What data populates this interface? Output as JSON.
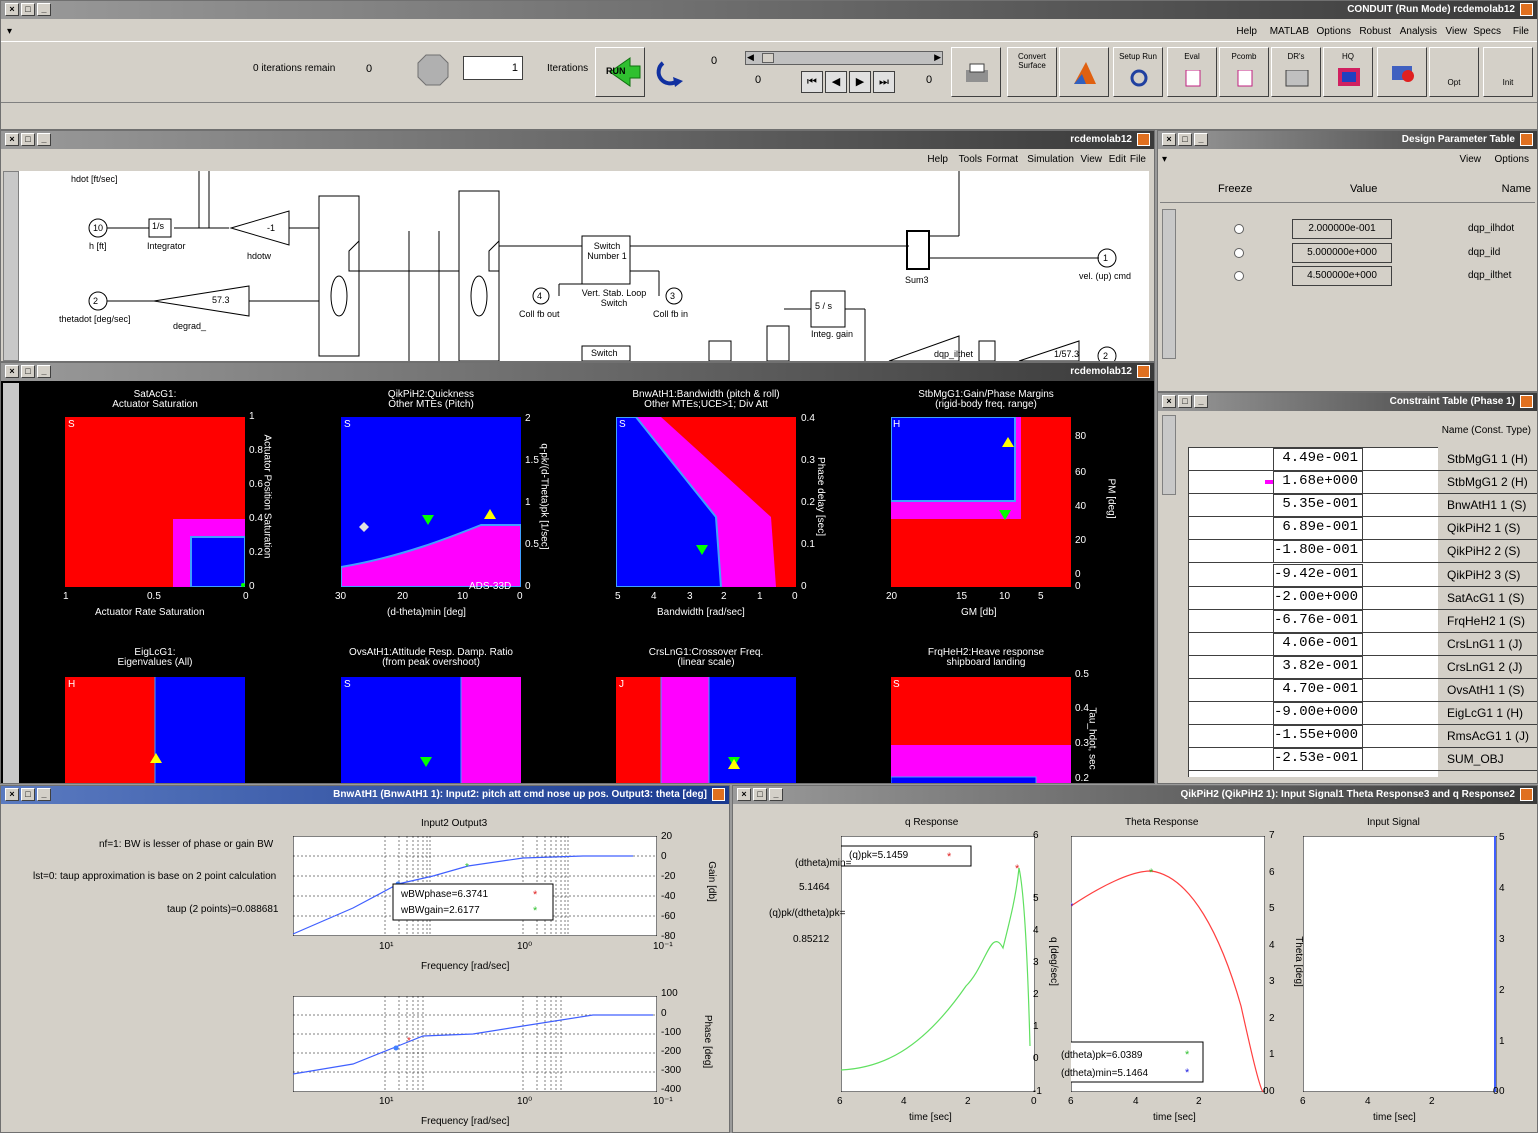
{
  "main": {
    "title": "CONDUIT (Run Mode)  rcdemolab12",
    "menus": [
      "File",
      "Specs",
      "View",
      "Analysis",
      "Robust",
      "Options",
      "MATLAB",
      "Help"
    ],
    "iterations_remain_value": "0",
    "iterations_remain_label": "0 iterations remain",
    "iterations_label": "Iterations",
    "iterations_value": "1",
    "run_label": "RUN",
    "slider_left": "0",
    "slider_mid": "0",
    "slider_right": "0",
    "toolbar_labels": [
      "Init",
      "Opt",
      "",
      "HQ",
      "DR's",
      "Pcomb",
      "Eval",
      "Setup Run",
      "",
      "Convert Surface",
      "",
      "Print"
    ]
  },
  "sim": {
    "title": "rcdemolab12",
    "menus": [
      "File",
      "Edit",
      "View",
      "Simulation",
      "Format",
      "Tools",
      "Help"
    ],
    "blocks": {
      "hdot": "hdot [ft/sec]",
      "h_ft": "h [ft]",
      "integrator": "Integrator",
      "hdotw": "hdotw",
      "gain_neg1": "-1",
      "one_over_s": "1/s",
      "port10": "10",
      "port2": "2",
      "thetadot": "thetadot [deg/sec]",
      "degrad": "degrad_",
      "gain573": "57.3",
      "switch_number": "Switch Number 1",
      "vert_stab": "Vert. Stab. Loop Switch",
      "coll_fb_out": "Coll fb out",
      "coll_fb_in": "Coll fb in",
      "port4": "4",
      "port3": "3",
      "sum3": "Sum3",
      "vel_cmd": "vel. (up) cmd",
      "port1": "1",
      "integ_gain": "Integ. gain",
      "integ_block": "5 / s",
      "switch2": "Switch",
      "dqp_ilthet": "dqp_ilthet",
      "gain1573": "1/57.3",
      "port2b": "2"
    }
  },
  "dpt": {
    "title": "Design Parameter Table",
    "menus": [
      "Options",
      "View"
    ],
    "headers": {
      "name": "Name",
      "value": "Value",
      "freeze": "Freeze"
    },
    "rows": [
      {
        "name": "dqp_ilhdot",
        "value": "2.000000e-001"
      },
      {
        "name": "dqp_ild",
        "value": "5.000000e+000"
      },
      {
        "name": "dqp_ilthet",
        "value": "4.500000e+000"
      }
    ]
  },
  "ct": {
    "title": "Constraint Table (Phase 1)",
    "header": "Name (Const. Type)",
    "rows": [
      {
        "name": "StbMgG1 1  (H)",
        "value": "4.49e-001",
        "bar_color": "#0000ff",
        "bar": 0.45,
        "arrow": false
      },
      {
        "name": "StbMgG1 2  (H)",
        "value": "1.68e+000",
        "bar_color": "#ff00ff",
        "bar": 1.0,
        "arrow": false
      },
      {
        "name": "BnwAtH1 1  (S)",
        "value": "5.35e-001",
        "bar_color": "#0000ff",
        "bar": 0.5,
        "arrow": false
      },
      {
        "name": "QikPiH2 1  (S)",
        "value": "6.89e-001",
        "bar_color": "#0000ff",
        "bar": 0.62,
        "arrow": false
      },
      {
        "name": "QikPiH2 2  (S)",
        "value": "-1.80e-001",
        "bar_color": "#0000ff",
        "bar": 0.02,
        "arrow": false
      },
      {
        "name": "QikPiH2 3  (S)",
        "value": "-9.42e-001",
        "bar_color": "#0000ff",
        "bar": 0.4,
        "arrow": true
      },
      {
        "name": "SatAcG1 1  (S)",
        "value": "-2.00e+000",
        "bar_color": "#0000ff",
        "bar": 0.4,
        "arrow": true
      },
      {
        "name": "FrqHeH2 1  (S)",
        "value": "-6.76e-001",
        "bar_color": "#0000ff",
        "bar": 0.4,
        "arrow": true
      },
      {
        "name": "CrsLnG1 1  (J)",
        "value": "4.06e-001",
        "bar_color": "#0000ff",
        "bar": 0.4,
        "arrow": false
      },
      {
        "name": "CrsLnG1 2  (J)",
        "value": "3.82e-001",
        "bar_color": "#0000ff",
        "bar": 0.38,
        "arrow": false
      },
      {
        "name": "OvsAtH1 1  (S)",
        "value": "4.70e-001",
        "bar_color": "#0000ff",
        "bar": 0.47,
        "arrow": false
      },
      {
        "name": "EigLcG1 1  (H)",
        "value": "-9.00e+000",
        "bar_color": "#0000ff",
        "bar": 0.4,
        "arrow": true
      },
      {
        "name": "RmsAcG1 1  (J)",
        "value": "-1.55e+000",
        "bar_color": "#0000ff",
        "bar": 0.4,
        "arrow": true
      },
      {
        "name": "SUM_OBJ",
        "value": "-2.53e-001",
        "bar_color": "#0000ff",
        "bar": 0.4,
        "arrow": true
      }
    ]
  },
  "specs": {
    "title": "rcdemolab12",
    "panels": [
      {
        "title": "StbMgG1:Gain/Phase Margins",
        "subtitle": "(rigid-body freq. range)",
        "xlabel": "GM [db]",
        "ylabel": "PM [deg]",
        "letter": "H",
        "xticks": [
          "0",
          "5",
          "10",
          "15",
          "20"
        ],
        "yticks": [
          "0",
          "20",
          "40",
          "60",
          "80"
        ]
      },
      {
        "title": "BnwAtH1:Bandwidth (pitch & roll)",
        "subtitle": "Other MTEs;UCE>1; Div Att",
        "xlabel": "Bandwidth [rad/sec]",
        "ylabel": "Phase delay [sec]",
        "letter": "S",
        "xticks": [
          "0",
          "1",
          "2",
          "3",
          "4",
          "5"
        ],
        "yticks": [
          "0",
          "0.1",
          "0.2",
          "0.3",
          "0.4"
        ]
      },
      {
        "title": "QikPiH2:Quickness",
        "subtitle": "Other MTEs (Pitch)",
        "xlabel": "(d-theta)min [deg]",
        "ylabel": "q-pk/(d-Theta)pk [1/sec]",
        "letter": "S",
        "xticks": [
          "0",
          "10",
          "20",
          "30"
        ],
        "yticks": [
          "0",
          "0.5",
          "1",
          "1.5",
          "2"
        ],
        "note": "ADS-33D"
      },
      {
        "title": "SatAcG1:",
        "subtitle": "Actuator Saturation",
        "xlabel": "Actuator Rate Saturation",
        "ylabel": "Actuator Position Saturation",
        "letter": "S",
        "xticks": [
          "0",
          "0.5",
          "1"
        ],
        "yticks": [
          "0",
          "0.2",
          "0.4",
          "0.6",
          "0.8",
          "1"
        ]
      },
      {
        "title": "FrqHeH2:Heave response",
        "subtitle": "shipboard landing",
        "xlabel": "",
        "ylabel": "Tau_hdot, sec",
        "letter": "S",
        "xticks": [],
        "yticks": [
          "0.2",
          "0.3",
          "0.4",
          "0.5"
        ]
      },
      {
        "title": "CrsLnG1:Crossover Freq.",
        "subtitle": "(linear scale)",
        "xlabel": "",
        "ylabel": "",
        "letter": "J",
        "xticks": [],
        "yticks": []
      },
      {
        "title": "OvsAtH1:Attitude Resp. Damp. Ratio",
        "subtitle": "(from peak overshoot)",
        "xlabel": "",
        "ylabel": "",
        "letter": "S",
        "xticks": [],
        "yticks": []
      },
      {
        "title": "EigLcG1:",
        "subtitle": "Eigenvalues (All)",
        "xlabel": "",
        "ylabel": "",
        "letter": "H",
        "xticks": [],
        "yticks": []
      }
    ]
  },
  "bw": {
    "title": "BnwAtH1 (BnwAtH1 1): Input2: pitch att cmd nose up pos.  Output3: theta [deg]",
    "plot_title": "Input2 Output3",
    "gain_ylabel": "Gain [db]",
    "phase_ylabel": "Phase [deg]",
    "xlabel": "Frequency [rad/sec]",
    "gain_yticks": [
      "20",
      "0",
      "-20",
      "-40",
      "-60",
      "-80"
    ],
    "phase_yticks": [
      "100",
      "0",
      "-100",
      "-200",
      "-300",
      "-400"
    ],
    "xticks": [
      "10⁻¹",
      "10⁰",
      "10¹"
    ],
    "legend": [
      "wBWphase=6.3741",
      "wBWgain=2.6177"
    ],
    "notes": [
      "nf=1: BW is lesser of phase or gain BW",
      "lst=0: taup approximation is base on 2 point calculation",
      "taup (2 points)=0.088681"
    ]
  },
  "qik": {
    "title": "QikPiH2 (QikPiH2 1): Input Signal1 Theta Response3 and q Response2",
    "panels": [
      {
        "title": "Input Signal",
        "ylabel": "Theta [deg]",
        "xlabel": "time [sec]",
        "xticks": [
          "0",
          "2",
          "4",
          "6"
        ],
        "yticks": [
          "0",
          "1",
          "2",
          "3",
          "4",
          "5"
        ]
      },
      {
        "title": "Theta Response",
        "ylabel": "Theta [deg]",
        "xlabel": "time [sec]",
        "xticks": [
          "0",
          "2",
          "4",
          "6"
        ],
        "yticks": [
          "0",
          "1",
          "2",
          "3",
          "4",
          "5",
          "6",
          "7"
        ]
      },
      {
        "title": "q Response",
        "ylabel": "q [deg/sec]",
        "xlabel": "time [sec]",
        "xticks": [
          "0",
          "2",
          "4",
          "6"
        ],
        "yticks": [
          "-1",
          "0",
          "1",
          "2",
          "3",
          "4",
          "5",
          "6"
        ]
      }
    ],
    "theta_legend": [
      "(dtheta)pk=6.0389",
      "(dtheta)min=5.1464"
    ],
    "q_legend": "(q)pk=5.1459",
    "q_notes": [
      "(dtheta)min=",
      "5.1464",
      "(q)pk/(dtheta)pk=",
      "0.85212"
    ]
  }
}
